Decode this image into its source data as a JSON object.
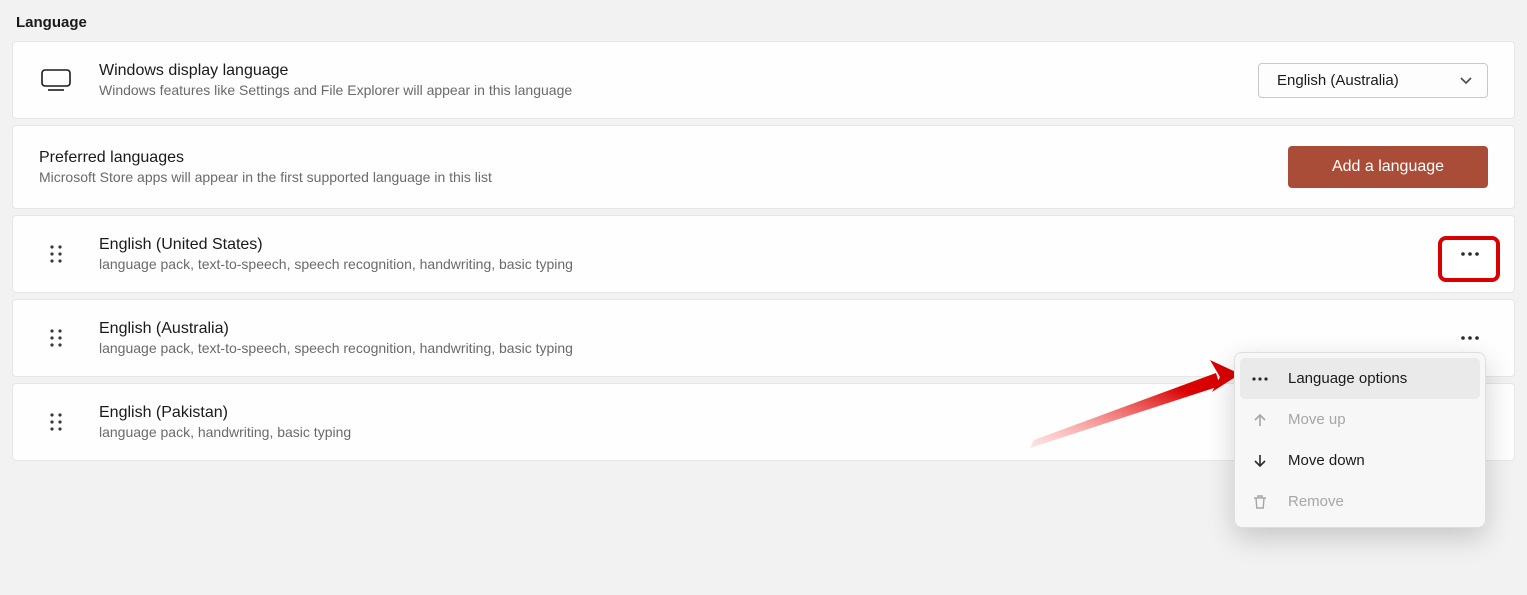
{
  "section_title": "Language",
  "display_language": {
    "title": "Windows display language",
    "subtitle": "Windows features like Settings and File Explorer will appear in this language",
    "selected": "English (Australia)"
  },
  "preferred": {
    "title": "Preferred languages",
    "subtitle": "Microsoft Store apps will appear in the first supported language in this list",
    "add_button": "Add a language"
  },
  "languages": [
    {
      "name": "English (United States)",
      "features": "language pack, text-to-speech, speech recognition, handwriting, basic typing"
    },
    {
      "name": "English (Australia)",
      "features": "language pack, text-to-speech, speech recognition, handwriting, basic typing"
    },
    {
      "name": "English (Pakistan)",
      "features": "language pack, handwriting, basic typing"
    }
  ],
  "context_menu": {
    "language_options": "Language options",
    "move_up": "Move up",
    "move_down": "Move down",
    "remove": "Remove"
  }
}
